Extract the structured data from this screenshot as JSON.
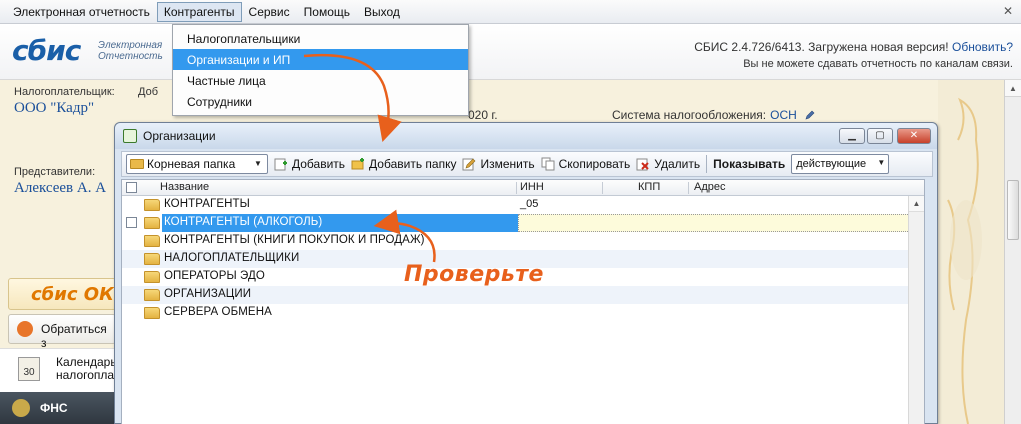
{
  "menubar": {
    "items": [
      "Электронная отчетность",
      "Контрагенты",
      "Сервис",
      "Помощь",
      "Выход"
    ],
    "active_index": 1
  },
  "banner": {
    "logo": "сбис",
    "logo_sub1": "Электронная",
    "logo_sub2": "Отчетность",
    "version_text": "СБИС 2.4.726/6413. Загружена новая версия!",
    "update_link": "Обновить?",
    "warning": "Вы не можете сдавать отчетность по каналам связи."
  },
  "taxpayer": {
    "label": "Налогоплательщик:",
    "tab_label": "Доб",
    "name": "ООО \"Кадр\"",
    "period": "020 г.",
    "tax_system_label": "Система налогообложения:",
    "tax_system_value": "ОСН"
  },
  "representative": {
    "label": "Представители:",
    "name": "Алексеев А. А"
  },
  "left_panel": {
    "online_logo": "сбис ОК",
    "contact_btn": "Обратиться з",
    "calendar_num": "30",
    "calendar_line1": "Календарь",
    "calendar_line2": "налогопла",
    "fns": "ФНС"
  },
  "dropdown": {
    "items": [
      "Налогоплательщики",
      "Организации и ИП",
      "Частные лица",
      "Сотрудники"
    ],
    "highlighted_index": 1
  },
  "window": {
    "title": "Организации",
    "toolbar": {
      "folder": "Корневая папка",
      "add": "Добавить",
      "add_folder": "Добавить папку",
      "edit": "Изменить",
      "copy": "Скопировать",
      "delete": "Удалить",
      "show_label": "Показывать",
      "show_value": "действующие"
    },
    "columns": [
      "Название",
      "ИНН",
      "КПП",
      "Адрес"
    ],
    "rows": [
      {
        "name": "КОНТРАГЕНТЫ",
        "inn": "_05"
      },
      {
        "name": "КОНТРАГЕНТЫ (АЛКОГОЛЬ)",
        "inn": ""
      },
      {
        "name": "КОНТРАГЕНТЫ (КНИГИ ПОКУПОК И ПРОДАЖ)",
        "inn": ""
      },
      {
        "name": "НАЛОГОПЛАТЕЛЬЩИКИ",
        "inn": ""
      },
      {
        "name": "ОПЕРАТОРЫ ЭДО",
        "inn": ""
      },
      {
        "name": "ОРГАНИЗАЦИИ",
        "inn": ""
      },
      {
        "name": "СЕРВЕРА ОБМЕНА",
        "inn": ""
      }
    ],
    "selected_row": 1
  },
  "callout": {
    "text": "Проверьте",
    "color": "#e8601c"
  },
  "colors": {
    "accent": "#3399ee",
    "link": "#1a4f9a"
  }
}
